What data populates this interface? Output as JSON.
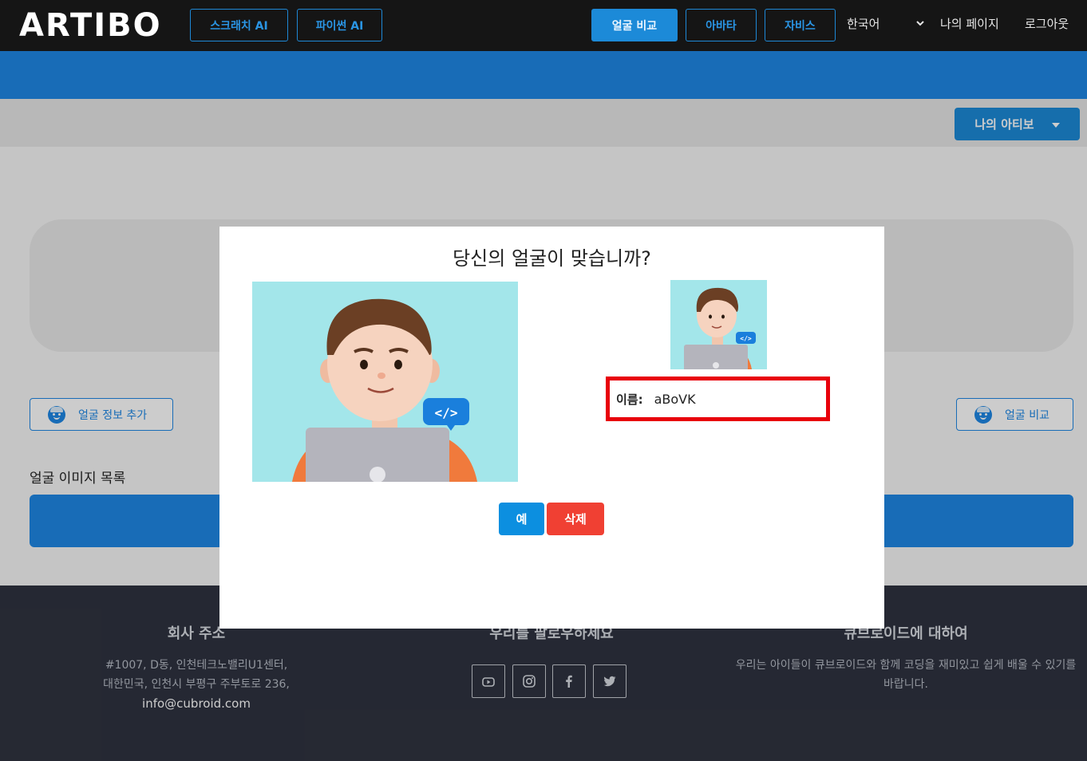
{
  "header": {
    "logo_text": "ARTIBO",
    "nav": [
      {
        "label": "스크래치 AI"
      },
      {
        "label": "파이썬 AI"
      },
      {
        "label": "얼굴 비교"
      },
      {
        "label": "아바타"
      },
      {
        "label": "자비스"
      }
    ],
    "language": "한국어",
    "my_page": "나의 페이지",
    "logout": "로그아웃"
  },
  "toolbar": {
    "my_artibo": "나의 아티보"
  },
  "main": {
    "add_face_info": "얼굴 정보 추가",
    "compare_face": "얼굴 비교",
    "list_title": "얼굴 이미지 목록"
  },
  "modal": {
    "title": "당신의 얼굴이 맞습니까?",
    "name_label": "이름:",
    "name_value": "aBoVK",
    "yes_label": "예",
    "delete_label": "삭제"
  },
  "footer": {
    "address_title": "회사 주소",
    "address_line1": "#1007, D동, 인천테크노밸리U1센터,",
    "address_line2": "대한민국, 인천시 부평구 주부토로 236,",
    "email": "info@cubroid.com",
    "follow_title": "우리를 팔로우하세요",
    "about_title": "큐브로이드에 대하여",
    "about_text": "우리는 아이들이 큐브로이드와 함께 코딩을 재미있고 쉽게 배울 수 있기를 바랍니다."
  },
  "colors": {
    "accent": "#1e88e5",
    "danger": "#f04033",
    "highlight_border": "#e8000b",
    "photo_background": "#a3e6ea"
  }
}
